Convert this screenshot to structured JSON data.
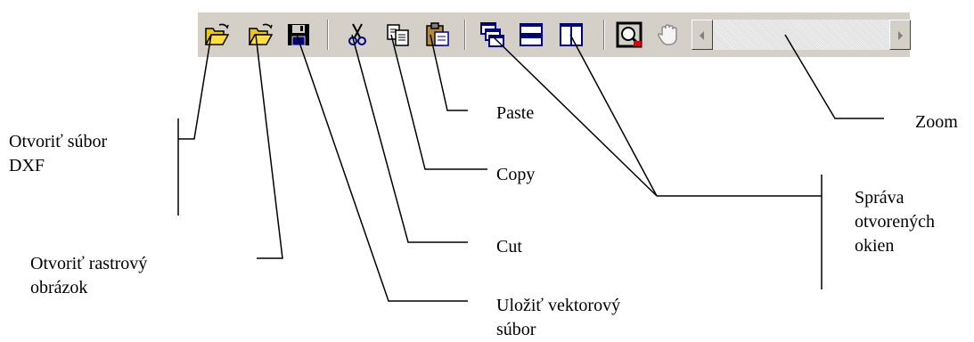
{
  "toolbar": {
    "buttons": [
      {
        "id": "open-dxf",
        "icon": "open-folder-icon"
      },
      {
        "id": "open-raster",
        "icon": "open-folder-icon"
      },
      {
        "id": "save",
        "icon": "floppy-disk-icon"
      },
      {
        "id": "cut",
        "icon": "scissors-icon"
      },
      {
        "id": "copy",
        "icon": "copy-icon"
      },
      {
        "id": "paste",
        "icon": "paste-icon"
      },
      {
        "id": "cascade",
        "icon": "cascade-windows-icon"
      },
      {
        "id": "tile-horizontal",
        "icon": "tile-horizontal-icon"
      },
      {
        "id": "tile-vertical",
        "icon": "tile-vertical-icon"
      },
      {
        "id": "zoom",
        "icon": "zoom-icon"
      },
      {
        "id": "pan",
        "icon": "hand-icon"
      }
    ],
    "scrollbar": {
      "left_arrow": "scroll-left-icon",
      "right_arrow": "scroll-right-icon"
    }
  },
  "labels": {
    "open_dxf": [
      "Otvoriť súbor",
      "DXF"
    ],
    "open_raster": [
      "Otvoriť rastrový",
      "obrázok"
    ],
    "save_vector": [
      "Uložiť vektorový",
      "súbor"
    ],
    "cut": "Cut",
    "copy": "Copy",
    "paste": "Paste",
    "windows": [
      "Správa",
      "otvorených",
      "okien"
    ],
    "zoom": "Zoom"
  },
  "colors": {
    "toolbar_bg": "#d4d0c8",
    "folder_yellow": "#f0c800",
    "blue": "#000080",
    "line": "#000000"
  }
}
